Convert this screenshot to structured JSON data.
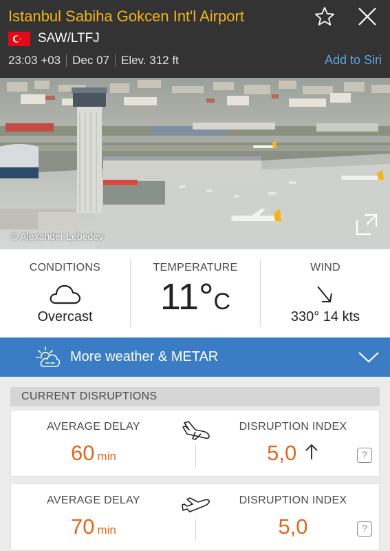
{
  "header": {
    "title": "Istanbul Sabiha Gokcen Int'l Airport",
    "code": "SAW/LTFJ",
    "time": "23:03 +03",
    "date": "Dec 07",
    "elevation": "Elev. 312 ft",
    "siri_label": "Add to Siri",
    "accent_color": "#f2b51a",
    "icons": {
      "favorite": "star-icon",
      "close": "close-icon",
      "flag": "turkey-flag-icon"
    }
  },
  "photo": {
    "credit": "© Alexander Lebedev",
    "expand_icon": "expand-icon"
  },
  "weather": {
    "conditions": {
      "label": "CONDITIONS",
      "value": "Overcast",
      "icon": "cloud-icon"
    },
    "temperature": {
      "label": "TEMPERATURE",
      "value": "11°",
      "unit": "C"
    },
    "wind": {
      "label": "WIND",
      "value": "330° 14 kts",
      "icon": "wind-arrow-icon"
    }
  },
  "more_weather": {
    "label": "More weather & METAR",
    "icon": "weather-sun-cloud-icon",
    "chevron": "chevron-down-icon",
    "color": "#3b7dc4"
  },
  "disruptions": {
    "title": "CURRENT DISRUPTIONS",
    "accent_color": "#e0671c",
    "rows": [
      {
        "direction": "arrivals",
        "delay_label": "AVERAGE DELAY",
        "delay_value": "60",
        "delay_unit": "min",
        "index_label": "DISRUPTION INDEX",
        "index_value": "5,0",
        "trend": "up",
        "help": "?"
      },
      {
        "direction": "departures",
        "delay_label": "AVERAGE DELAY",
        "delay_value": "70",
        "delay_unit": "min",
        "index_label": "DISRUPTION INDEX",
        "index_value": "5,0",
        "trend": "none",
        "help": "?"
      }
    ]
  }
}
